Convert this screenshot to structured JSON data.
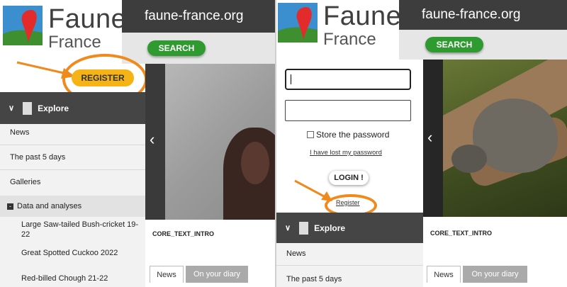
{
  "left": {
    "logo": {
      "title": "Faune",
      "subtitle": "France"
    },
    "domain": "faune-france.org",
    "search_label": "SEARCH",
    "register_label": "REGISTER",
    "sidebar": {
      "explore_label": "Explore",
      "items": [
        "News",
        "The past 5 days",
        "Galleries"
      ],
      "section_label": "Data and analyses",
      "sub_items": [
        "Large Saw-tailed Bush-cricket 19-22",
        "Great Spotted Cuckoo 2022",
        "Red-billed Chough 21-22"
      ]
    },
    "intro_label": "CORE_TEXT_INTRO",
    "tabs": [
      "News",
      "On your diary"
    ]
  },
  "right": {
    "logo": {
      "title": "Faune",
      "subtitle": "France"
    },
    "domain": "faune-france.org",
    "search_label": "SEARCH",
    "login": {
      "store_password_label": "Store the password",
      "lost_password_link": "I have lost my password",
      "login_label": "LOGIN !",
      "register_link": "Register"
    },
    "sidebar": {
      "explore_label": "Explore",
      "items": [
        "News",
        "The past 5 days"
      ]
    },
    "intro_label": "CORE_TEXT_INTRO",
    "tabs": [
      "News",
      "On your diary"
    ]
  },
  "colors": {
    "accent_green": "#2f9a2f",
    "register_orange": "#f6b316",
    "highlight_orange": "#f08a1c",
    "dark_bar": "#3d3d3d"
  }
}
